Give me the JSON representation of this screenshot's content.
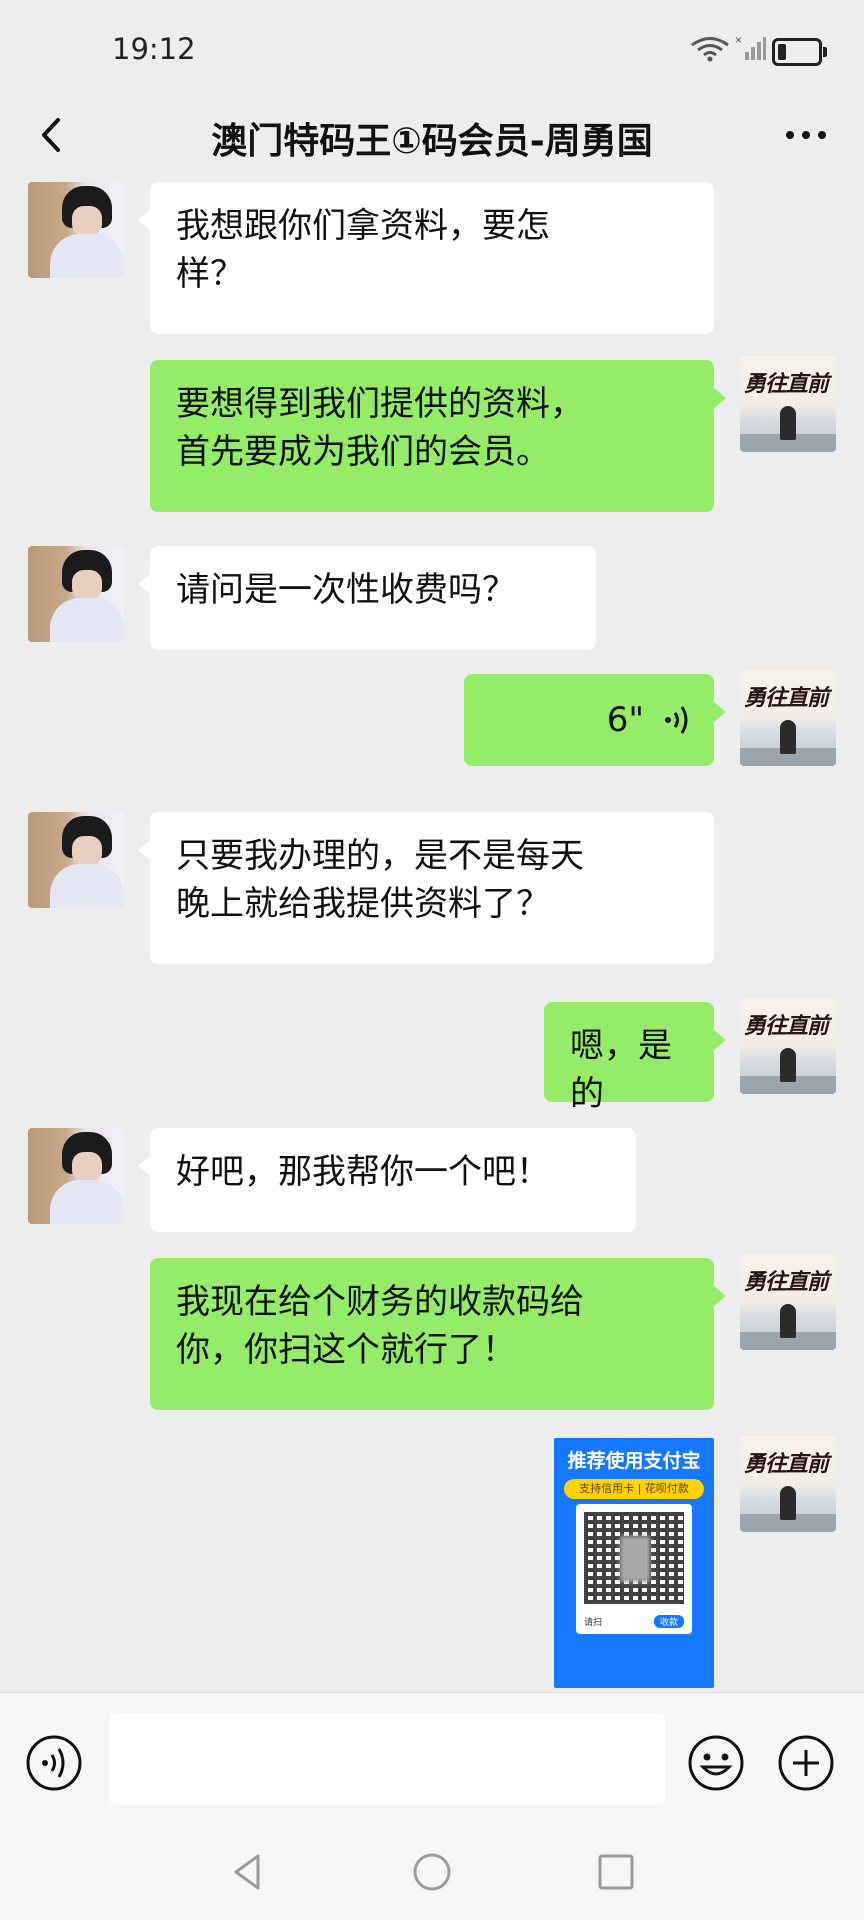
{
  "status_bar": {
    "time": "19:12"
  },
  "header": {
    "title": "澳门特码王①码会员-周勇国"
  },
  "avatars": {
    "right_caption": "勇往直前"
  },
  "messages": [
    {
      "side": "left",
      "text": "我想跟你们拿资料，要怎\n样？"
    },
    {
      "side": "right",
      "text": "要想得到我们提供的资料，\n首先要成为我们的会员。"
    },
    {
      "side": "left",
      "text": "请问是一次性收费吗？"
    },
    {
      "side": "right",
      "type": "voice",
      "duration": "6\""
    },
    {
      "side": "left",
      "text": "只要我办理的，是不是每天\n晚上就给我提供资料了？"
    },
    {
      "side": "right",
      "text": "嗯，是的"
    },
    {
      "side": "left",
      "text": "好吧，那我帮你一个吧！"
    },
    {
      "side": "right",
      "text": "我现在给个财务的收款码给\n你，你扫这个就行了！"
    },
    {
      "side": "right",
      "type": "image",
      "qr": {
        "title": "推荐使用支付宝",
        "subtitle": "支持信用卡 | 花呗付款",
        "footer_left": "请扫",
        "footer_button": "收款"
      }
    }
  ],
  "input_bar": {
    "voice_icon": "voice-icon",
    "emoji_icon": "emoji-icon",
    "plus_icon": "plus-icon"
  },
  "nav_bar": {
    "back": "back-triangle-icon",
    "home": "home-circle-icon",
    "recents": "recents-square-icon"
  }
}
